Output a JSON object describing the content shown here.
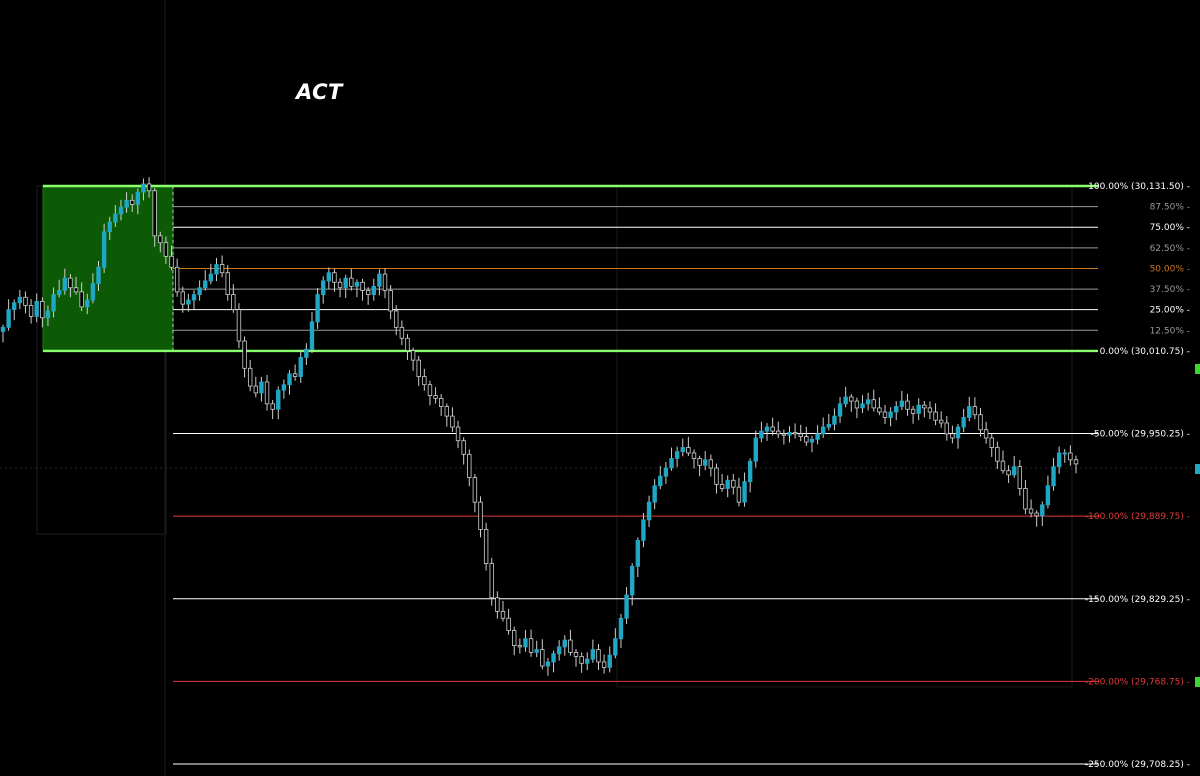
{
  "title": "ACT",
  "chart_data": {
    "type": "candlestick",
    "title": "ACT",
    "y_range": [
      29690,
      30145
    ],
    "colors": {
      "background": "#000000",
      "bull_candle": "#1fa7c4",
      "bear_candle": "#000000",
      "wick": "#cfcfcf",
      "zone_fill": "#0c5a06",
      "zone_edge": "#8aff6c",
      "fib_white": "#ffffff",
      "fib_grey": "#9a9a9a",
      "fib_red": "#e23a3a",
      "fib_orange": "#c8781f",
      "right_marker_green": "#3bd62f",
      "right_marker_blue": "#1fa7c4"
    },
    "fib_levels": [
      {
        "pct": "100.00%",
        "price": 30131.5,
        "label": "100.00% (30,131.50)",
        "style": "green"
      },
      {
        "pct": "87.50%",
        "price": 30116.41,
        "label": "87.50%",
        "style": "grey"
      },
      {
        "pct": "75.00%",
        "price": 30101.31,
        "label": "75.00%",
        "style": "white"
      },
      {
        "pct": "62.50%",
        "price": 30086.22,
        "label": "62.50%",
        "style": "grey"
      },
      {
        "pct": "50.00%",
        "price": 30071.13,
        "label": "50.00%",
        "style": "orange"
      },
      {
        "pct": "37.50%",
        "price": 30056.03,
        "label": "37.50%",
        "style": "grey"
      },
      {
        "pct": "25.00%",
        "price": 30040.94,
        "label": "25.00%",
        "style": "white"
      },
      {
        "pct": "12.50%",
        "price": 30025.84,
        "label": "12.50%",
        "style": "grey"
      },
      {
        "pct": "0.00%",
        "price": 30010.75,
        "label": "0.00% (30,010.75)",
        "style": "green"
      },
      {
        "pct": "-50.00%",
        "price": 29950.25,
        "label": "-50.00% (29,950.25)",
        "style": "white"
      },
      {
        "pct": "-100.00%",
        "price": 29889.75,
        "label": "-100.00% (29,889.75)",
        "style": "red"
      },
      {
        "pct": "-150.00%",
        "price": 29829.25,
        "label": "-150.00% (29,829.25)",
        "style": "white"
      },
      {
        "pct": "-200.00%",
        "price": 29768.75,
        "label": "-200.00% (29,768.75)",
        "style": "red"
      },
      {
        "pct": "-250.00%",
        "price": 29708.25,
        "label": "-250.00% (29,708.25)",
        "style": "white"
      }
    ],
    "zone": {
      "price_high": 30131.5,
      "price_low": 30010.75
    },
    "closes": [
      30028,
      30041,
      30046,
      30050,
      30044,
      30036,
      30047,
      30035,
      30040,
      30052,
      30055,
      30064,
      30057,
      30054,
      30043,
      30048,
      30060,
      30072,
      30098,
      30105,
      30111,
      30116,
      30121,
      30118,
      30127,
      30133,
      30128,
      30095,
      30090,
      30080,
      30072,
      30054,
      30045,
      30048,
      30052,
      30057,
      30062,
      30067,
      30074,
      30068,
      30052,
      30041,
      30018,
      29998,
      29985,
      29980,
      29988,
      29972,
      29968,
      29982,
      29986,
      29994,
      29992,
      30006,
      30012,
      30032,
      30052,
      30062,
      30068,
      30061,
      30057,
      30064,
      30058,
      30061,
      30055,
      30052,
      30058,
      30067,
      30055,
      30040,
      30028,
      30020,
      30011,
      30004,
      29992,
      29986,
      29978,
      29976,
      29970,
      29963,
      29955,
      29945,
      29935,
      29918,
      29900,
      29880,
      29855,
      29830,
      29820,
      29815,
      29806,
      29795,
      29794,
      29800,
      29790,
      29792,
      29780,
      29783,
      29789,
      29794,
      29799,
      29790,
      29787,
      29782,
      29785,
      29792,
      29783,
      29779,
      29788,
      29800,
      29815,
      29832,
      29853,
      29872,
      29887,
      29900,
      29912,
      29919,
      29925,
      29932,
      29937,
      29940,
      29936,
      29932,
      29927,
      29931,
      29925,
      29913,
      29910,
      29916,
      29911,
      29900,
      29915,
      29930,
      29947,
      29952,
      29955,
      29952,
      29950,
      29949,
      29951,
      29950,
      29948,
      29944,
      29946,
      29950,
      29955,
      29957,
      29963,
      29972,
      29977,
      29974,
      29969,
      29972,
      29975,
      29969,
      29966,
      29962,
      29966,
      29970,
      29974,
      29968,
      29965,
      29971,
      29969,
      29966,
      29960,
      29958,
      29950,
      29947,
      29955,
      29962,
      29970,
      29964,
      29953,
      29947,
      29940,
      29930,
      29923,
      29920,
      29926,
      29910,
      29895,
      29892,
      29890,
      29898,
      29912,
      29926,
      29936,
      29936,
      29931,
      29928
    ]
  }
}
